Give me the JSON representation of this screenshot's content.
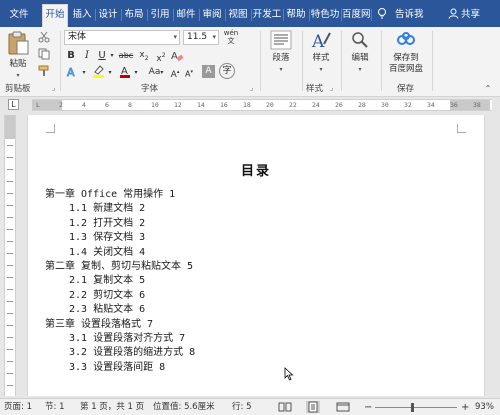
{
  "tabs": [
    {
      "label": "文件",
      "active": false
    },
    {
      "label": "开始",
      "active": true
    },
    {
      "label": "插入",
      "active": false
    },
    {
      "label": "设计",
      "active": false
    },
    {
      "label": "布局",
      "active": false
    },
    {
      "label": "引用",
      "active": false
    },
    {
      "label": "邮件",
      "active": false
    },
    {
      "label": "审阅",
      "active": false
    },
    {
      "label": "视图",
      "active": false
    },
    {
      "label": "开发工",
      "active": false
    },
    {
      "label": "帮助",
      "active": false
    },
    {
      "label": "特色功",
      "active": false
    },
    {
      "label": "百度网",
      "active": false
    }
  ],
  "tell_me": "告诉我",
  "share": "共享",
  "ribbon": {
    "paste_label": "粘贴",
    "clipboard_group": "剪贴板",
    "font_group": "字体",
    "paragraph_group": "段落",
    "paragraph_btn": "段落",
    "style_group": "样式",
    "style_btn": "样式",
    "edit_btn": "编辑",
    "save_group": "保存",
    "save_btn_line1": "保存到",
    "save_btn_line2": "百度网盘",
    "font_name": "宋体",
    "font_size": "11.5",
    "wen_icon": "wén",
    "accent_color": "#2b579a",
    "font_color": "#c00000",
    "highlight_color": "#ffff00"
  },
  "ruler": {
    "h_ticks": [
      "L",
      "2",
      "4",
      "6",
      "8",
      "10",
      "12",
      "14",
      "16",
      "18",
      "20",
      "22",
      "24",
      "26",
      "28",
      "30",
      "32",
      "34",
      "36",
      "38"
    ]
  },
  "document": {
    "title": "目录",
    "entries": [
      {
        "level": 1,
        "text": "第一章 Office 常用操作 1"
      },
      {
        "level": 2,
        "text": "1.1 新建文档 2"
      },
      {
        "level": 2,
        "text": "1.2 打开文档 2"
      },
      {
        "level": 2,
        "text": "1.3 保存文档 3"
      },
      {
        "level": 2,
        "text": "1.4 关闭文档 4"
      },
      {
        "level": 1,
        "text": "第二章 复制、剪切与粘贴文本 5"
      },
      {
        "level": 2,
        "text": "2.1 复制文本 5"
      },
      {
        "level": 2,
        "text": "2.2 剪切文本 6"
      },
      {
        "level": 2,
        "text": "2.3 粘贴文本 6"
      },
      {
        "level": 1,
        "text": "第三章 设置段落格式 7"
      },
      {
        "level": 2,
        "text": "3.1 设置段落对齐方式 7"
      },
      {
        "level": 2,
        "text": "3.2 设置段落的缩进方式 8"
      },
      {
        "level": 2,
        "text": "3.3 设置段落间距 8"
      }
    ]
  },
  "status": {
    "page": "页面: 1",
    "section": "节: 1",
    "page_of": "第 1 页，共 1 页",
    "position": "位置值: 5.6厘米",
    "row": "行: 5",
    "zoom_minus": "−",
    "zoom_plus": "+",
    "zoom_value": "93%",
    "zoom_level": 0.93
  }
}
